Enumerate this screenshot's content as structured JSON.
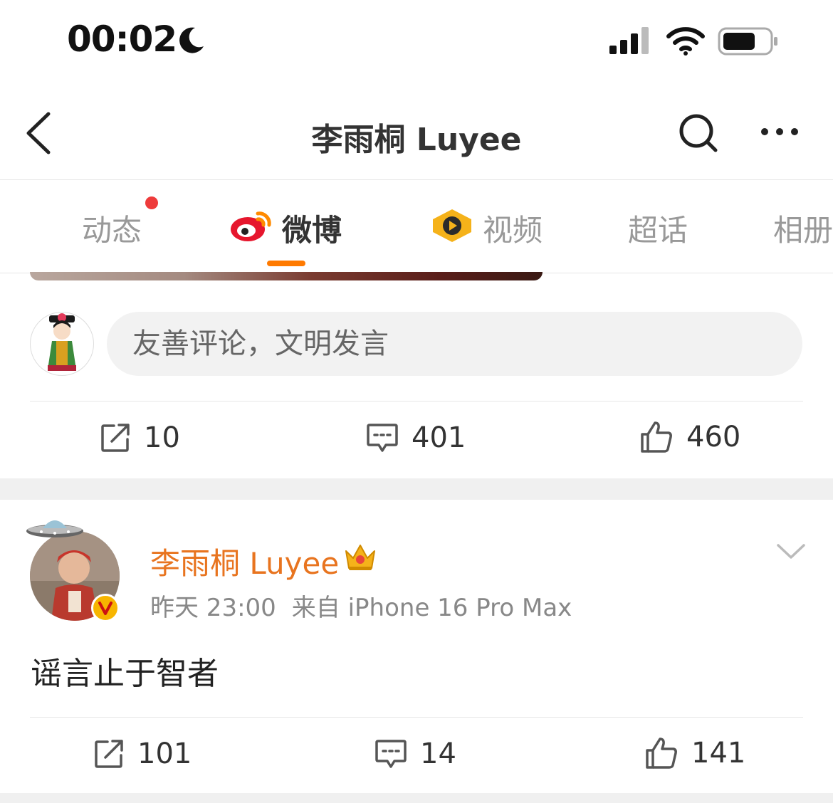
{
  "status_bar": {
    "time": "00:02",
    "icons": [
      "moon-icon",
      "signal-icon",
      "wifi-icon",
      "battery-icon"
    ]
  },
  "header": {
    "title": "李雨桐 Luyee",
    "icons": [
      "back-arrow-icon",
      "search-icon",
      "more-icon"
    ]
  },
  "tabs": [
    {
      "label": "动态",
      "has_dot": true
    },
    {
      "label": "微博",
      "active": true,
      "icon": "weibo-logo-icon"
    },
    {
      "label": "视频",
      "icon": "video-play-icon"
    },
    {
      "label": "超话"
    },
    {
      "label": "相册"
    }
  ],
  "comment_box": {
    "placeholder": "友善评论，文明发言"
  },
  "post1_actions": {
    "reposts": "10",
    "comments": "401",
    "likes": "460"
  },
  "post2": {
    "author": "李雨桐 Luyee",
    "time": "昨天 23:00",
    "source": "来自 iPhone 16 Pro Max",
    "text": "谣言止于智者",
    "actions": {
      "reposts": "101",
      "comments": "14",
      "likes": "141"
    }
  },
  "colors": {
    "accent_orange": "#ff7a00",
    "author_orange": "#e8741f",
    "notification_red": "#ee3b3b"
  }
}
